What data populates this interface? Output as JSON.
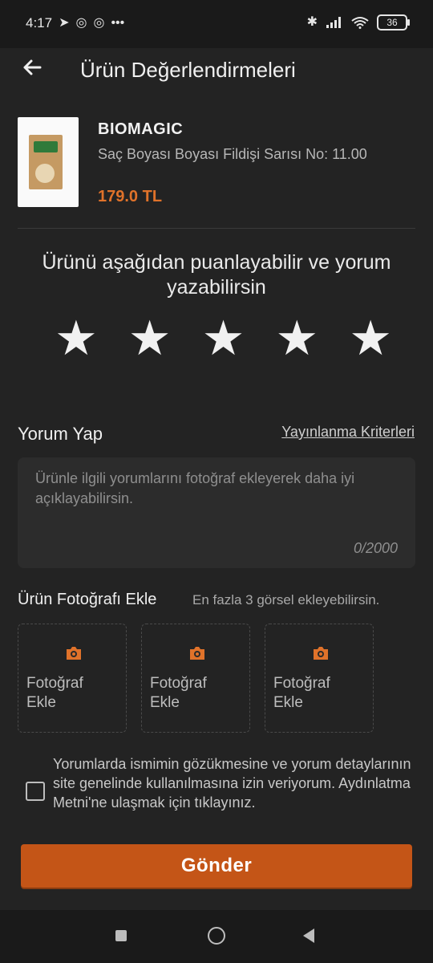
{
  "status": {
    "time": "4:17",
    "left_icons": [
      "telegram-icon",
      "messenger-icon",
      "messenger-icon",
      "more-dots-icon"
    ],
    "battery": "36"
  },
  "header": {
    "title": "Ürün Değerlendirmeleri"
  },
  "product": {
    "brand": "BIOMAGIC",
    "name": "Saç Boyası Boyası Fildişi Sarısı No: 11.00",
    "price": "179.0 TL"
  },
  "rating": {
    "prompt": "Ürünü aşağıdan puanlayabilir ve yorum yazabilirsin",
    "stars": [
      "★",
      "★",
      "★",
      "★",
      "★"
    ]
  },
  "review": {
    "heading": "Yorum Yap",
    "criteria_link": "Yayınlanma Kriterleri",
    "placeholder": "Ürünle ilgili yorumlarını fotoğraf ekleyerek daha iyi açıklayabilirsin.",
    "counter": "0/2000"
  },
  "photos": {
    "heading": "Ürün Fotoğrafı Ekle",
    "subtitle": "En fazla 3 görsel ekleyebilirsin.",
    "slots": [
      {
        "label": "Fotoğraf Ekle"
      },
      {
        "label": "Fotoğraf Ekle"
      },
      {
        "label": "Fotoğraf Ekle"
      }
    ]
  },
  "consent": {
    "text": "Yorumlarda ismimin gözükmesine ve yorum detaylarının site genelinde kullanılmasına izin veriyorum. Aydınlatma Metni'ne ulaşmak için tıklayınız."
  },
  "submit": {
    "label": "Gönder"
  },
  "colors": {
    "accent": "#c45517",
    "price": "#e0722a",
    "background": "#232323"
  }
}
